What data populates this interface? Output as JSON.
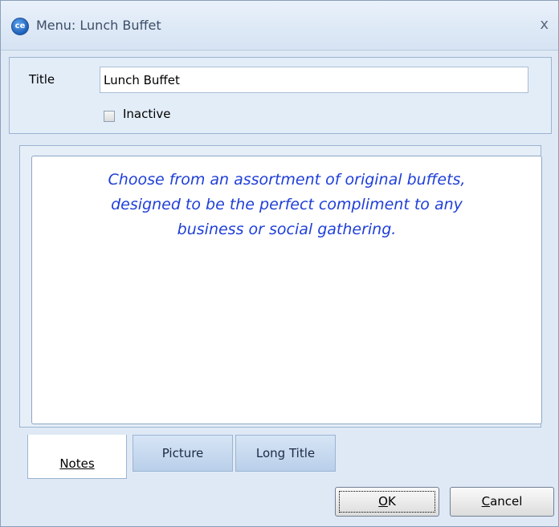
{
  "window": {
    "title": "Menu:  Lunch Buffet",
    "close_symbol": "x",
    "app_icon": "ce-logo-icon",
    "app_icon_text": "ce"
  },
  "header": {
    "title_label": "Title",
    "title_value": "Lunch Buffet",
    "inactive_label": "Inactive",
    "inactive_checked": false
  },
  "notes": {
    "line1": "Choose from an assortment of original buffets,",
    "line2": "designed to be the perfect compliment to any",
    "line3": "business or social gathering."
  },
  "tabs": [
    {
      "label": "Notes",
      "selected": true
    },
    {
      "label": "Picture",
      "selected": false
    },
    {
      "label": "Long Title",
      "selected": false
    }
  ],
  "buttons": {
    "ok_first": "O",
    "ok_rest": "K",
    "cancel_first": "C",
    "cancel_rest": "ancel"
  },
  "colors": {
    "notes_text": "#1f3fd8",
    "titlebar": "#dfe9f5"
  }
}
